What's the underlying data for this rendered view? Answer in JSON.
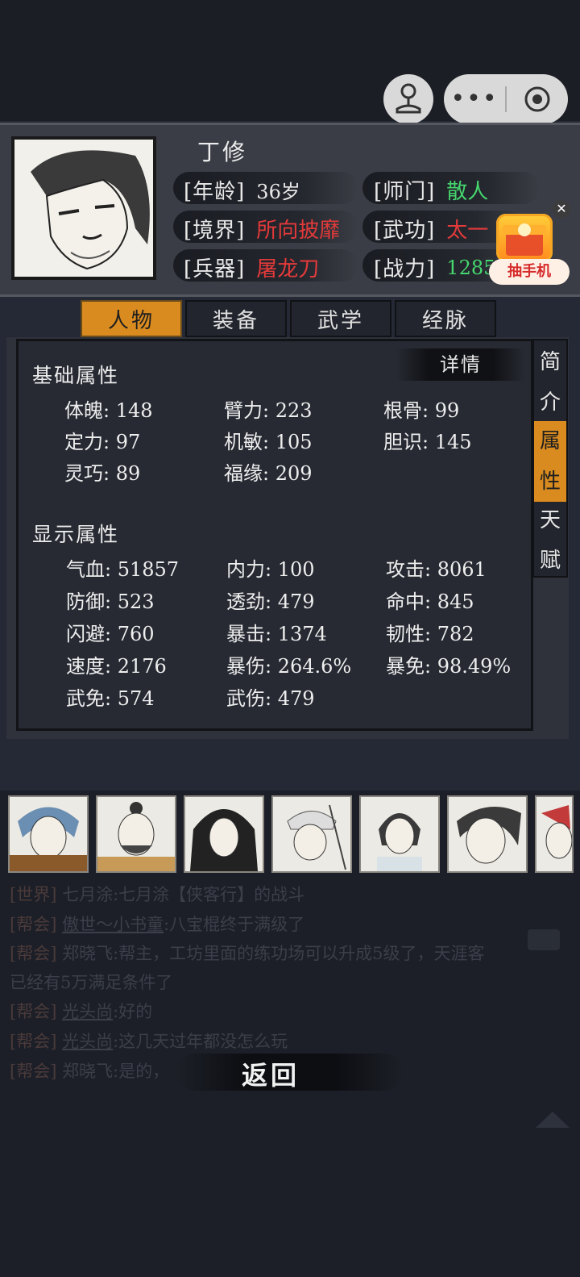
{
  "profile": {
    "name": "丁修",
    "age_label": "[年龄]",
    "age_value": "36岁",
    "sect_label": "[师门]",
    "sect_value": "散人",
    "realm_label": "[境界]",
    "realm_value": "所向披靡",
    "martial_label": "[武功]",
    "martial_value": "太一",
    "weapon_label": "[兵器]",
    "weapon_value": "屠龙刀",
    "power_label": "[战力]",
    "power_value": "12855"
  },
  "ad": {
    "label": "抽手机",
    "close": "✕"
  },
  "capsule": {
    "dots": "•••"
  },
  "tabs": [
    "人物",
    "装备",
    "武学",
    "经脉"
  ],
  "side_tabs": [
    {
      "chars": [
        "简",
        "介"
      ]
    },
    {
      "chars": [
        "属",
        "性"
      ]
    },
    {
      "chars": [
        "天",
        "赋"
      ]
    }
  ],
  "panel": {
    "details_label": "详情",
    "basic_title": "基础属性",
    "basic_stats": [
      "体魄: 148",
      "臂力: 223",
      "根骨: 99",
      "定力: 97",
      "机敏: 105",
      "胆识: 145",
      "灵巧: 89",
      "福缘: 209"
    ],
    "display_title": "显示属性",
    "display_stats": [
      "气血: 51857",
      "内力: 100",
      "攻击: 8061",
      "防御: 523",
      "透劲: 479",
      "命中: 845",
      "闪避: 760",
      "暴击: 1374",
      "韧性: 782",
      "速度: 2176",
      "暴伤: 264.6%",
      "暴免: 98.49%",
      "武免: 574",
      "武伤: 479"
    ]
  },
  "chat": [
    {
      "channel": "[世界]",
      "user": "七月涂",
      "text": ":七月涂【侠客行】的战斗"
    },
    {
      "channel": "[帮会]",
      "user": "傲世～小书童",
      "text": ":八宝棍终于满级了"
    },
    {
      "channel": "[帮会]",
      "user": "郑晓飞",
      "text": ":帮主，工坊里面的练功场可以升成5级了，天涯客"
    },
    {
      "channel": "",
      "user": "",
      "text": "已经有5万满足条件了"
    },
    {
      "channel": "[帮会]",
      "user": "光头尚",
      "text": ":好的"
    },
    {
      "channel": "[帮会]",
      "user": "光头尚",
      "text": ":这几天过年都没怎么玩"
    },
    {
      "channel": "[帮会]",
      "user": "郑晓飞",
      "text": ":是的，"
    }
  ],
  "back_label": "返回"
}
